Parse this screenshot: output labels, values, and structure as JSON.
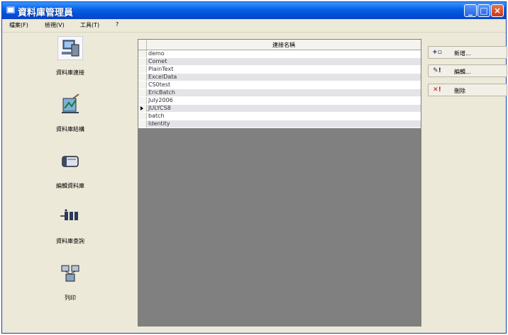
{
  "window": {
    "title": "資料庫管理員"
  },
  "menu": {
    "items": [
      "檔案(F)",
      "檢視(V)",
      "工具(T)",
      "?"
    ]
  },
  "nav": {
    "items": [
      {
        "label": "資料庫連接",
        "icon": "database-connection-icon"
      },
      {
        "label": "資料庫結構",
        "icon": "database-structure-icon"
      },
      {
        "label": "編輯資料庫",
        "icon": "edit-database-icon"
      },
      {
        "label": "資料庫查詢",
        "icon": "database-query-icon"
      },
      {
        "label": "列印",
        "icon": "print-icon"
      }
    ]
  },
  "grid": {
    "column_header": "連接名稱",
    "selected_index": 7,
    "rows": [
      "demo",
      "Comet",
      "PlainText",
      "ExcelData",
      "CS0test",
      "EricBatch",
      "July2006",
      "JULYCS8",
      "batch",
      "Identity"
    ]
  },
  "actions": {
    "add": {
      "label": "新增...",
      "icon": "add-icon"
    },
    "edit": {
      "label": "編輯...",
      "icon": "edit-icon"
    },
    "delete": {
      "label": "刪除",
      "icon": "delete-icon"
    }
  },
  "colors": {
    "titlebar": "#0a5ae0",
    "window_bg": "#ece9d8",
    "grid_bg": "#808080"
  }
}
